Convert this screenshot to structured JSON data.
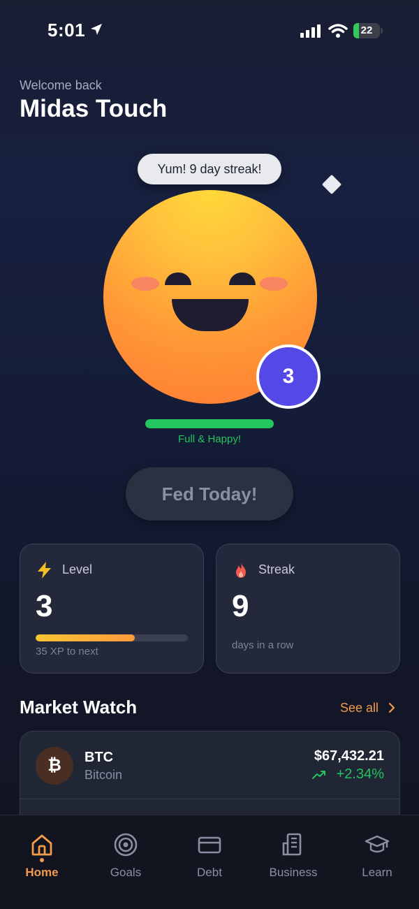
{
  "status_bar": {
    "time": "5:01",
    "battery": "22",
    "battery_level": 0.22
  },
  "header": {
    "welcome": "Welcome back",
    "title": "Midas Touch"
  },
  "pet": {
    "speech": "Yum! 9 day streak!",
    "level": "3",
    "hunger_level": 1.0,
    "hunger_label": "Full & Happy!",
    "hunger_color": "#22c55e"
  },
  "fed_button": {
    "label": "Fed Today!"
  },
  "stats": {
    "level": {
      "label": "Level",
      "value": "3",
      "xp_progress": 0.65,
      "sub": "35 XP to next",
      "icon": "lightning-icon"
    },
    "streak": {
      "label": "Streak",
      "value": "9",
      "sub": "days in a row",
      "icon": "flame-icon"
    }
  },
  "market": {
    "title": "Market Watch",
    "see_all": "See all",
    "items": [
      {
        "icon": "bitcoin-icon",
        "glyph": "₿",
        "symbol": "BTC",
        "name": "Bitcoin",
        "price": "$67,432.21",
        "change": "+2.34%"
      }
    ]
  },
  "tabs": [
    {
      "label": "Home",
      "icon": "home-icon",
      "active": true
    },
    {
      "label": "Goals",
      "icon": "target-icon",
      "active": false
    },
    {
      "label": "Debt",
      "icon": "card-icon",
      "active": false
    },
    {
      "label": "Business",
      "icon": "building-icon",
      "active": false
    },
    {
      "label": "Learn",
      "icon": "graduation-cap-icon",
      "active": false
    }
  ],
  "colors": {
    "accent": "#f39a4b",
    "positive": "#22c55e",
    "badge": "#5448e6",
    "background": "#151a30"
  }
}
